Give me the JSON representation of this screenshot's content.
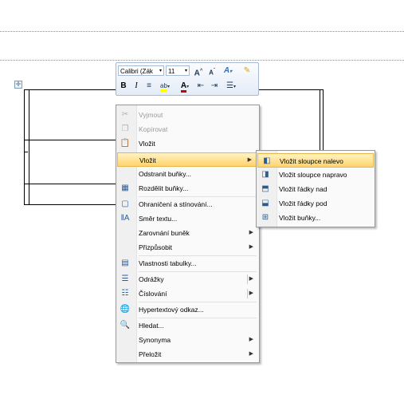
{
  "toolbar": {
    "font_name": "Calibri (Zák",
    "font_size": "11",
    "grow_font": "A",
    "shrink_font": "A",
    "styles": "A",
    "bold": "B",
    "italic": "I",
    "highlight_color": "#ffff00",
    "font_color": "#d00000"
  },
  "menu": {
    "items": [
      {
        "label": "Vyjmout",
        "icon": "scissors-icon",
        "disabled": true
      },
      {
        "label": "Kopírovat",
        "icon": "copy-icon",
        "disabled": true
      },
      {
        "label": "Vložit",
        "icon": "paste-icon"
      },
      {
        "label": "Vložit",
        "icon": "",
        "submenu": true,
        "highlighted": true
      },
      {
        "label": "Odstranit buňky...",
        "icon": ""
      },
      {
        "label": "Rozdělit buňky...",
        "icon": "split-cells-icon"
      },
      {
        "label": "Ohraničení a stínování...",
        "icon": "borders-icon"
      },
      {
        "label": "Směr textu...",
        "icon": "text-direction-icon"
      },
      {
        "label": "Zarovnání buněk",
        "icon": "",
        "submenu": true
      },
      {
        "label": "Přizpůsobit",
        "icon": "",
        "submenu": true
      },
      {
        "label": "Vlastnosti tabulky...",
        "icon": "table-properties-icon"
      },
      {
        "label": "Odrážky",
        "icon": "bullets-icon",
        "submenu": true,
        "split": true
      },
      {
        "label": "Číslování",
        "icon": "numbering-icon",
        "submenu": true,
        "split": true
      },
      {
        "label": "Hypertextový odkaz...",
        "icon": "hyperlink-icon"
      },
      {
        "label": "Hledat...",
        "icon": "search-icon"
      },
      {
        "label": "Synonyma",
        "icon": "",
        "submenu": true
      },
      {
        "label": "Přeložit",
        "icon": "",
        "submenu": true
      }
    ]
  },
  "submenu": {
    "items": [
      {
        "label": "Vložit sloupce nalevo",
        "icon": "insert-column-left-icon",
        "highlighted": true
      },
      {
        "label": "Vložit sloupce napravo",
        "icon": "insert-column-right-icon"
      },
      {
        "label": "Vložit řádky nad",
        "icon": "insert-row-above-icon"
      },
      {
        "label": "Vložit řádky pod",
        "icon": "insert-row-below-icon"
      },
      {
        "label": "Vložit buňky...",
        "icon": "insert-cells-icon"
      }
    ]
  }
}
